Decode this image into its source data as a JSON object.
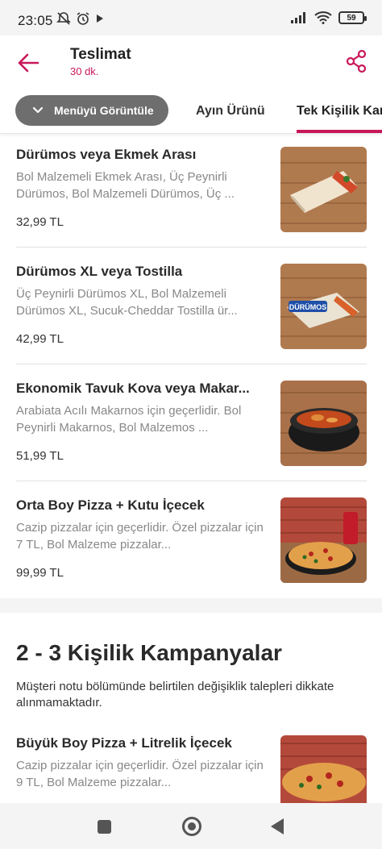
{
  "status_bar": {
    "time": "23:05",
    "battery": "59",
    "icons": [
      "notifications-off-icon",
      "alarm-icon",
      "play-icon",
      "signal-icon",
      "wifi-icon",
      "battery-icon"
    ]
  },
  "header": {
    "title": "Teslimat",
    "subtitle": "30 dk.",
    "accent_color": "#c8185a"
  },
  "tabs": {
    "menu_button": "Menüyü Görüntüle",
    "items": [
      {
        "label": "Ayın Ürünü"
      },
      {
        "label": "Tek Kişilik Kampanyalar"
      }
    ],
    "active_index": 1
  },
  "products": [
    {
      "name": "Dürümos veya Ekmek Arası",
      "desc": "Bol Malzemeli Ekmek Arası, Üç Peynirli Dürümos, Bol Malzemeli Dürümos, Üç ...",
      "price": "32,99 TL",
      "image": "wrap-image"
    },
    {
      "name": "Dürümos XL veya Tostilla",
      "desc": "Üç Peynirli Dürümos XL, Bol Malzemeli Dürümos XL, Sucuk-Cheddar Tostilla ür...",
      "price": "42,99 TL",
      "image": "durumos-xl-image",
      "image_label": "DÜRÜMOS"
    },
    {
      "name": "Ekonomik Tavuk Kova veya Makar...",
      "desc": "Arabiata Acılı Makarnos için geçerlidir. Bol Peynirli Makarnos,  Bol Malzemos ...",
      "price": "51,99 TL",
      "image": "chicken-bucket-image"
    },
    {
      "name": "Orta Boy Pizza + Kutu İçecek",
      "desc": "Cazip pizzalar için geçerlidir. Özel pizzalar için 7 TL, Bol Malzeme pizzalar...",
      "price": "99,99 TL",
      "image": "pizza-can-image"
    }
  ],
  "section": {
    "title": "2 - 3 Kişilik Kampanyalar",
    "note": "Müşteri notu bölümünde belirtilen değişiklik talepleri dikkate alınmamaktadır."
  },
  "section_products": [
    {
      "name": "Büyük Boy Pizza + Litrelik İçecek",
      "desc": "Cazip pizzalar için geçerlidir. Özel pizzalar için 9 TL, Bol Malzeme pizzalar...",
      "image": "large-pizza-image"
    }
  ],
  "nav_bar": {
    "icons": [
      "recents-icon",
      "home-icon",
      "back-icon"
    ]
  }
}
